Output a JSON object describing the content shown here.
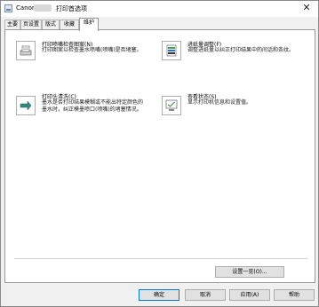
{
  "window": {
    "brand": "Canon",
    "title_suffix": "打印首选项",
    "close_glyph": "✕"
  },
  "tabs": [
    {
      "label": "主要"
    },
    {
      "label": "页设置"
    },
    {
      "label": "版式"
    },
    {
      "label": "收藏"
    },
    {
      "label": "维护"
    }
  ],
  "tools": {
    "nozzle_check": {
      "title": "打印喷嘴检查图案(N)",
      "desc": "打印图案以检查墨水喷嘴(喷嘴)是否堵塞。",
      "icon": "printer-page-icon"
    },
    "cleaning": {
      "title": "打印头清洗(C)",
      "desc_line1": "墨水是否打印结果模糊或不能出特定颜色的",
      "desc_line2": "墨水时，纠正模墨喷口(喷嘴)的堵塞情况。",
      "icon": "cleaning-icon"
    },
    "paper_feed": {
      "title": "进纸量调整(F)",
      "desc": "调整进纸量以纠正打印结果中的间话和条纹。",
      "icon": "color-chart-icon"
    },
    "status": {
      "title": "查看状态(S)",
      "desc": "显示打印机信息和设置值。",
      "icon": "status-monitor-icon"
    }
  },
  "settings_button": "设置一览(O)...",
  "footer": {
    "ok": "确定",
    "cancel": "取消",
    "apply": "应用(A)",
    "help": "帮助"
  }
}
